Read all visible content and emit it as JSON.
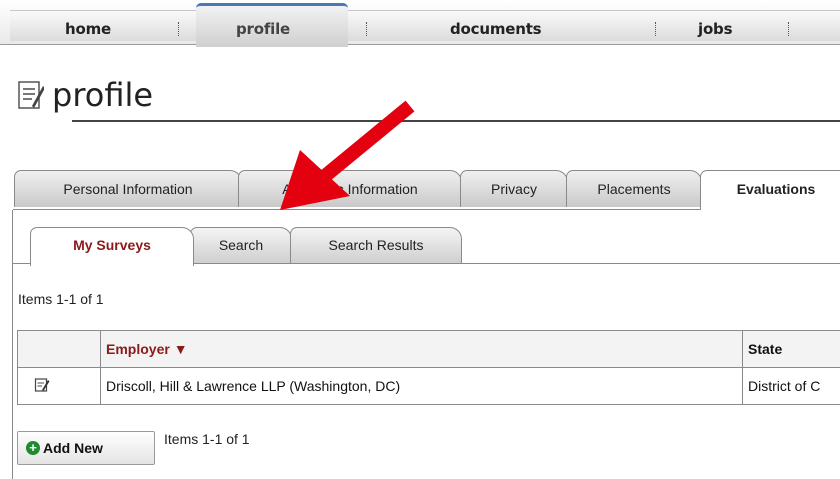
{
  "nav": {
    "items": [
      {
        "label": "home"
      },
      {
        "label": "profile",
        "active": true
      },
      {
        "label": "documents"
      },
      {
        "label": "jobs"
      }
    ]
  },
  "page": {
    "title": "profile"
  },
  "tabs": [
    {
      "label": "Personal Information"
    },
    {
      "label": "Academic Information"
    },
    {
      "label": "Privacy"
    },
    {
      "label": "Placements"
    },
    {
      "label": "Evaluations",
      "active": true
    }
  ],
  "subtabs": [
    {
      "label": "My Surveys",
      "active": true
    },
    {
      "label": "Search"
    },
    {
      "label": "Search Results"
    }
  ],
  "list": {
    "count_top": "Items 1-1 of 1",
    "count_bottom": "Items 1-1 of 1",
    "columns": [
      "Employer ▼",
      "State"
    ],
    "rows": [
      {
        "employer": "Driscoll, Hill & Lawrence LLP (Washington, DC)",
        "state": "District of C"
      }
    ]
  },
  "actions": {
    "add_new": "Add New"
  },
  "colors": {
    "accent_red": "#8b1a1a",
    "arrow": "#e3000f",
    "add_icon": "#1f8a2e"
  }
}
